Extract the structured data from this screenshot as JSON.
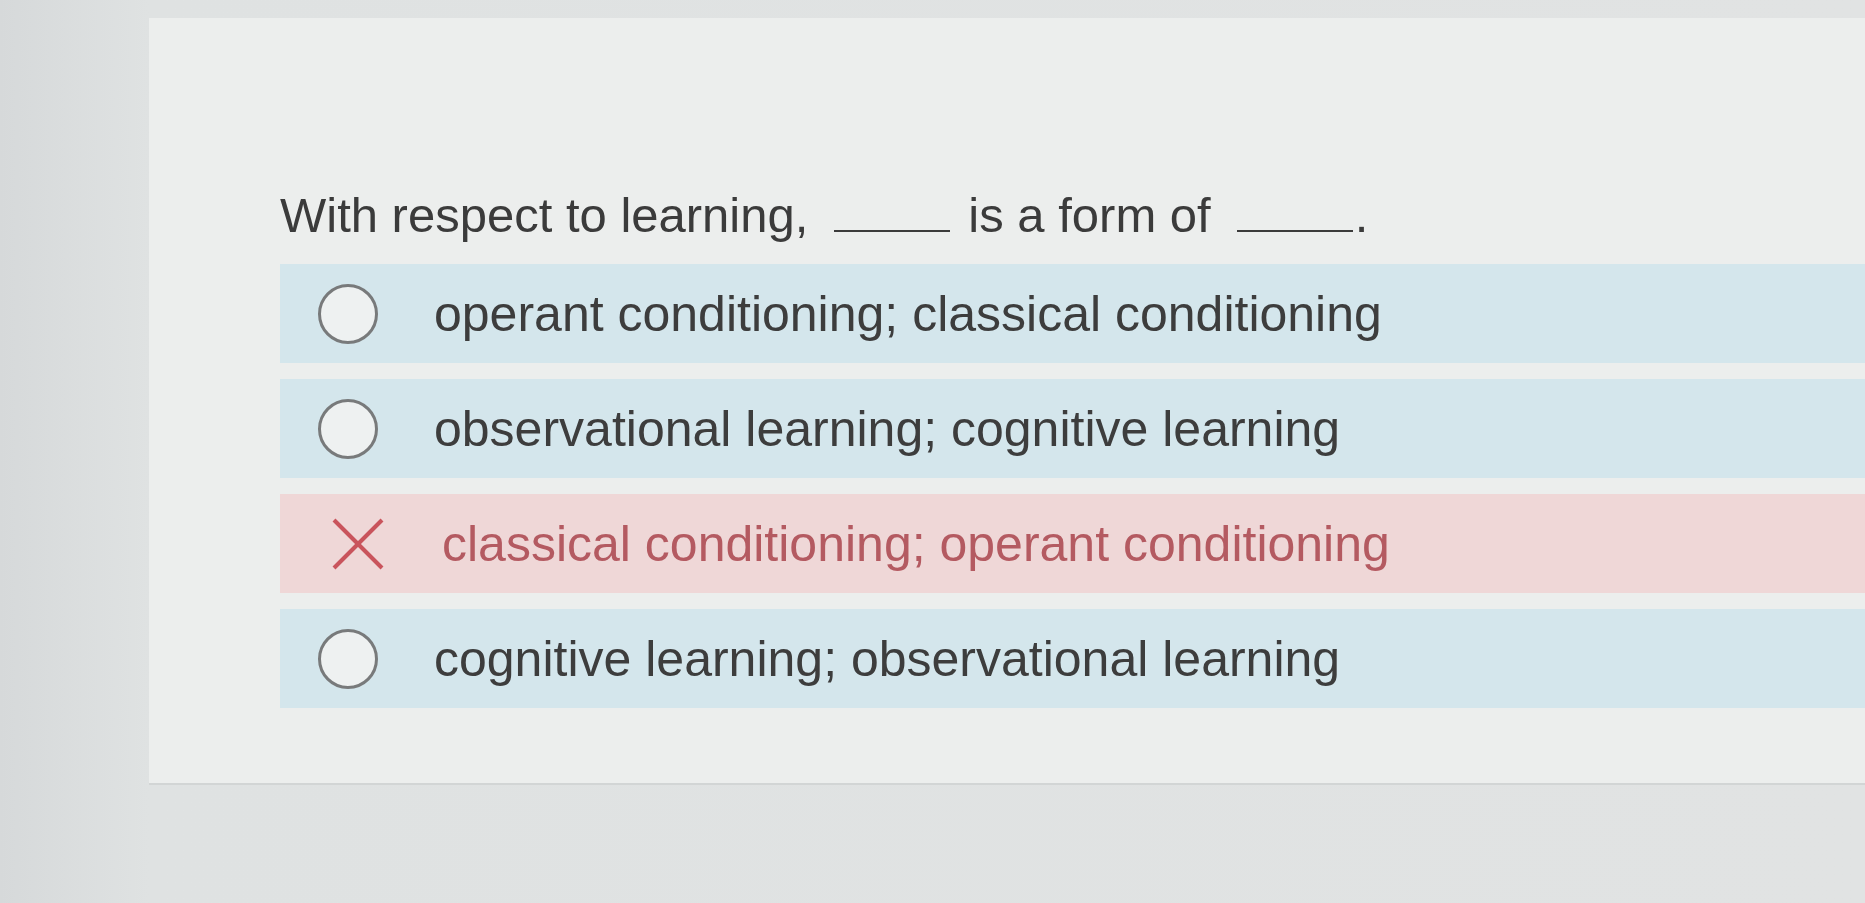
{
  "question": {
    "segments": [
      {
        "kind": "text",
        "text": "With respect to learning,"
      },
      {
        "kind": "blank"
      },
      {
        "kind": "text",
        "text": "is a form of"
      },
      {
        "kind": "blank"
      },
      {
        "kind": "text",
        "text": "."
      }
    ]
  },
  "options": [
    {
      "text": "operant conditioning; classical conditioning",
      "selected": false,
      "incorrect": false
    },
    {
      "text": "observational learning; cognitive learning",
      "selected": false,
      "incorrect": false
    },
    {
      "text": "classical conditioning; operant conditioning",
      "selected": true,
      "incorrect": true
    },
    {
      "text": "cognitive learning; observational learning",
      "selected": false,
      "incorrect": false
    }
  ]
}
